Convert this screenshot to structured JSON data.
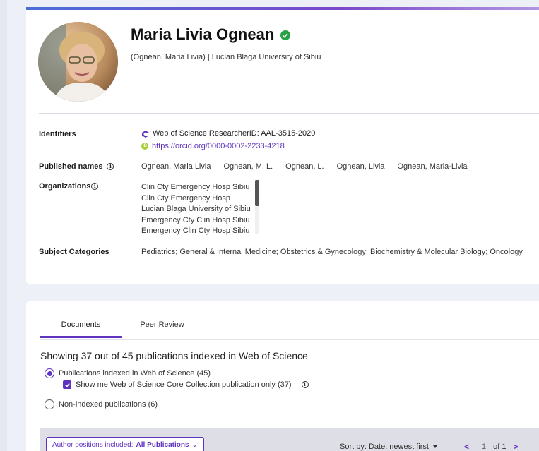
{
  "profile": {
    "name": "Maria Livia Ognean",
    "subtitle": "(Ognean, Maria Livia) | Lucian Blaga University of Sibiu",
    "identifiers_label": "Identifiers",
    "researcher_id": "Web of Science ResearcherID: AAL-3515-2020",
    "orcid_url": "https://orcid.org/0000-0002-2233-4218",
    "published_names_label": "Published names",
    "published_names": [
      "Ognean, Maria Livia",
      "Ognean, M. L.",
      "Ognean, L.",
      "Ognean, Livia",
      "Ognean, Maria-Livia"
    ],
    "organizations_label": "Organizations",
    "organizations": [
      "Clin Cty Emergency Hosp Sibiu",
      "Clin Cty Emergency Hosp",
      "Lucian Blaga University of Sibiu",
      "Emergency Cty Clin Hosp Sibiu",
      "Emergency Clin Cty Hosp Sibiu"
    ],
    "subject_categories_label": "Subject Categories",
    "subject_categories": "Pediatrics;  General & Internal Medicine;  Obstetrics & Gynecology;  Biochemistry & Molecular Biology;  Oncology",
    "info_glyph": "i"
  },
  "documents": {
    "tabs": [
      {
        "label": "Documents",
        "active": true
      },
      {
        "label": "Peer Review",
        "active": false
      }
    ],
    "showing_text": "Showing 37 out of 45 publications indexed in Web of Science",
    "radio_indexed": "Publications indexed in Web of Science (45)",
    "checkbox_core": "Show me Web of Science Core Collection publication only (37)",
    "radio_non_indexed": "Non-indexed publications (6)",
    "author_positions_prefix": "Author positions included:",
    "author_positions_value": "All Publications",
    "sort_label": "Sort by: Date: newest first",
    "page_current": "1",
    "page_total": "of 1",
    "prev_glyph": "<",
    "next_glyph": ">",
    "chevron_glyph": "⌄"
  },
  "colors": {
    "accent": "#5e33bf",
    "verified": "#29a144",
    "orcid": "#a6ce39"
  }
}
